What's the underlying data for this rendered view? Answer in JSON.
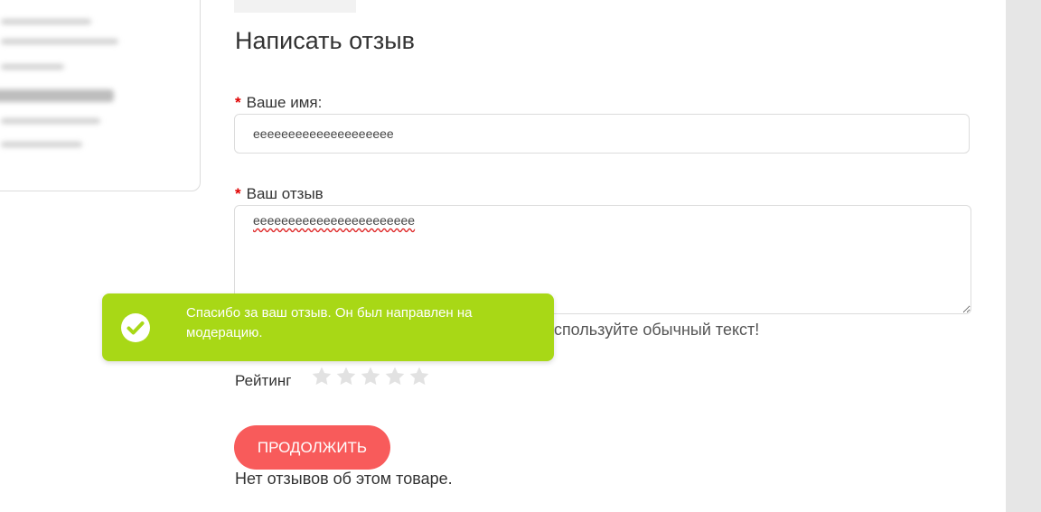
{
  "form": {
    "title": "Написать отзыв",
    "name_required_mark": "*",
    "name_label": "Ваше имя:",
    "name_value": "eeeeeeeeeeeeeeeeeeee",
    "review_required_mark": "*",
    "review_label": "Ваш отзыв",
    "review_value": "eeeeeeeeeeeeeeeeeeeeeee",
    "hint": "Используйте обычный текст!",
    "rating_label": "Рейтинг",
    "rating_value": 0,
    "rating_max": 5,
    "submit_label": "ПРОДОЛЖИТЬ",
    "no_reviews_text": "Нет отзывов об этом товаре."
  },
  "toast": {
    "message": "Спасибо за ваш отзыв. Он был направлен на модерацию.",
    "icon": "check-circle-icon"
  },
  "colors": {
    "accent_button": "#f85b5b",
    "toast_background": "#a8d816",
    "required_mark": "#e00000",
    "star_empty": "#e2e2e2"
  }
}
